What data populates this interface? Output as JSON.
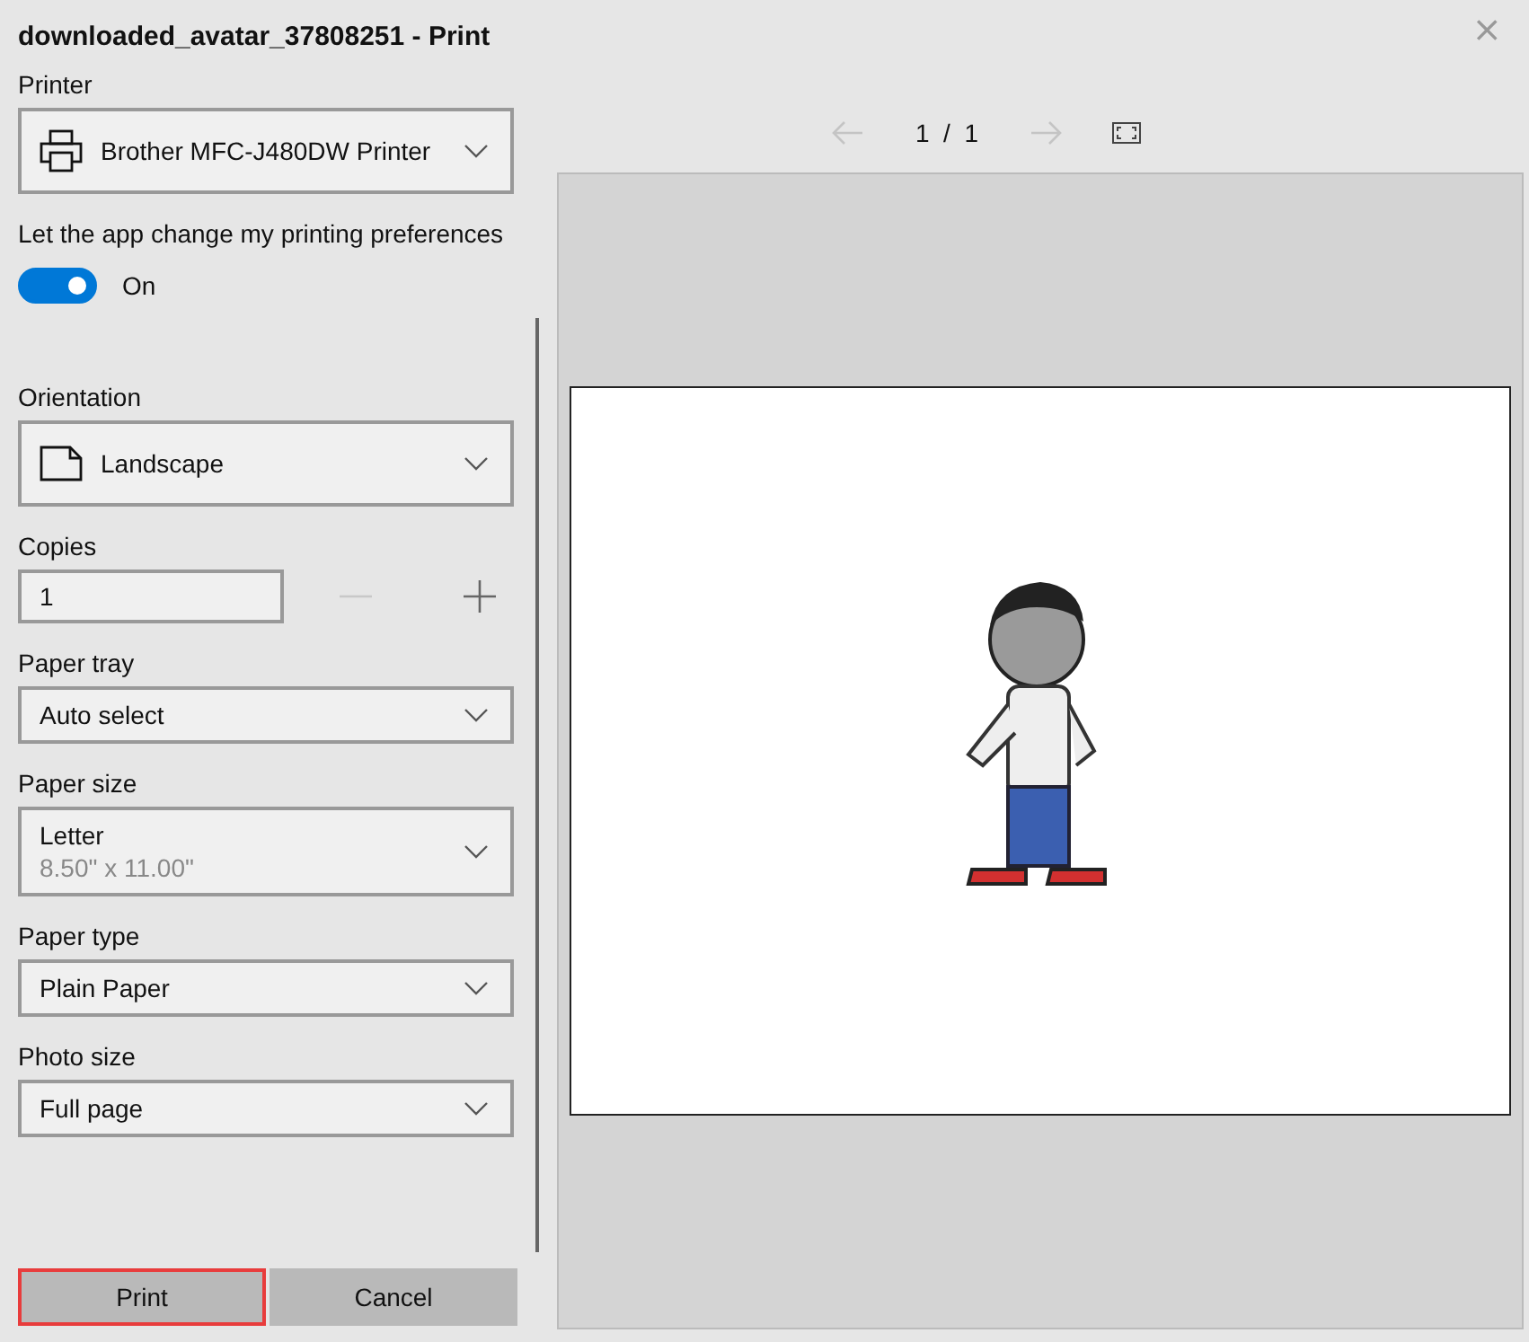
{
  "window": {
    "title": "downloaded_avatar_37808251 - Print",
    "close_icon": "×"
  },
  "settings": [
    {
      "kind": "dropdown",
      "label": "Printer",
      "value": "Brother MFC-J480DW Printer"
    },
    {
      "kind": "toggle",
      "label": "Let the app change my printing preferences",
      "on": true,
      "state_text": "On"
    },
    {
      "kind": "dropdown",
      "label": "Orientation",
      "value": "Landscape"
    },
    {
      "kind": "stepper",
      "label": "Copies",
      "value": "1",
      "minus_disabled": true,
      "plus_disabled": false
    },
    {
      "kind": "dropdown",
      "label": "Paper tray",
      "value": "Auto select"
    },
    {
      "kind": "dropdown",
      "label": "Paper size",
      "value": "Letter",
      "detail": "8.50\" x 11.00\""
    },
    {
      "kind": "dropdown",
      "label": "Paper type",
      "value": "Plain Paper"
    },
    {
      "kind": "dropdown",
      "label": "Photo size",
      "value": "Full page"
    }
  ],
  "buttons": [
    {
      "label": "Print",
      "focused": true
    },
    {
      "label": "Cancel",
      "focused": false
    }
  ],
  "preview": {
    "prev_disabled": true,
    "next_disabled": true,
    "page_label": "1  /  1"
  }
}
